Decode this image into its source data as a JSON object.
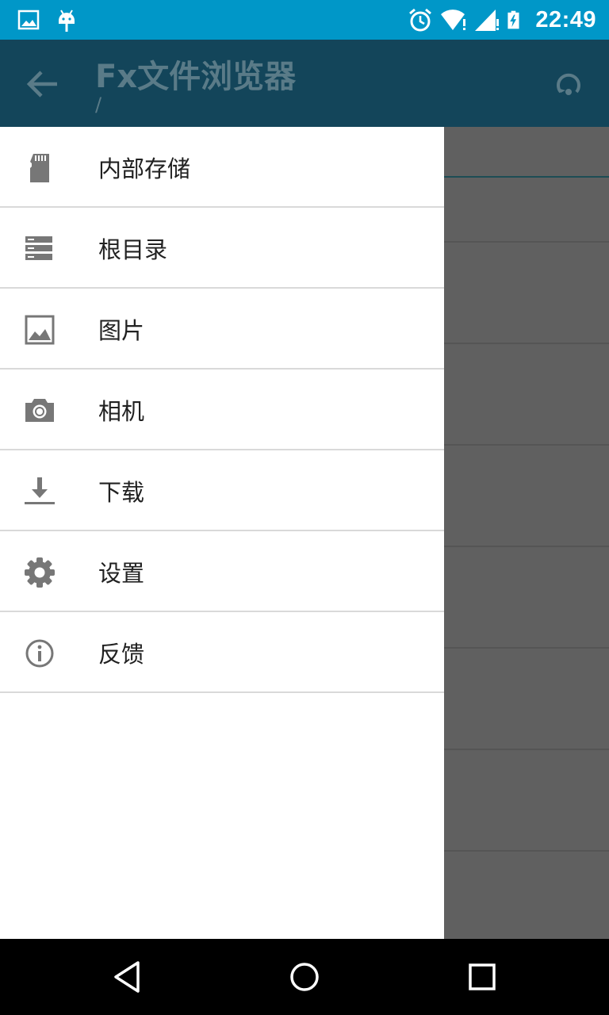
{
  "status_bar": {
    "time": "22:49",
    "left_icons": [
      "image-notification-icon",
      "android-debug-icon"
    ],
    "right_icons": [
      "alarm-icon",
      "wifi-icon",
      "cell-signal-icon",
      "battery-charging-icon"
    ],
    "background": "#0097c8"
  },
  "app_bar": {
    "title": "Fx文件浏览器",
    "subtitle": "/",
    "back_icon": "arrow-back-icon",
    "refresh_icon": "refresh-icon",
    "background": "#13455a"
  },
  "drawer": {
    "items": [
      {
        "label": "内部存储",
        "icon": "sd-card-icon"
      },
      {
        "label": "根目录",
        "icon": "storage-icon"
      },
      {
        "label": "图片",
        "icon": "image-icon"
      },
      {
        "label": "相机",
        "icon": "camera-icon"
      },
      {
        "label": "下载",
        "icon": "download-icon"
      },
      {
        "label": "设置",
        "icon": "settings-icon"
      },
      {
        "label": "反馈",
        "icon": "info-icon"
      }
    ]
  },
  "nav_bar": {
    "icons": [
      "back-triangle-icon",
      "home-circle-icon",
      "recents-square-icon"
    ]
  }
}
